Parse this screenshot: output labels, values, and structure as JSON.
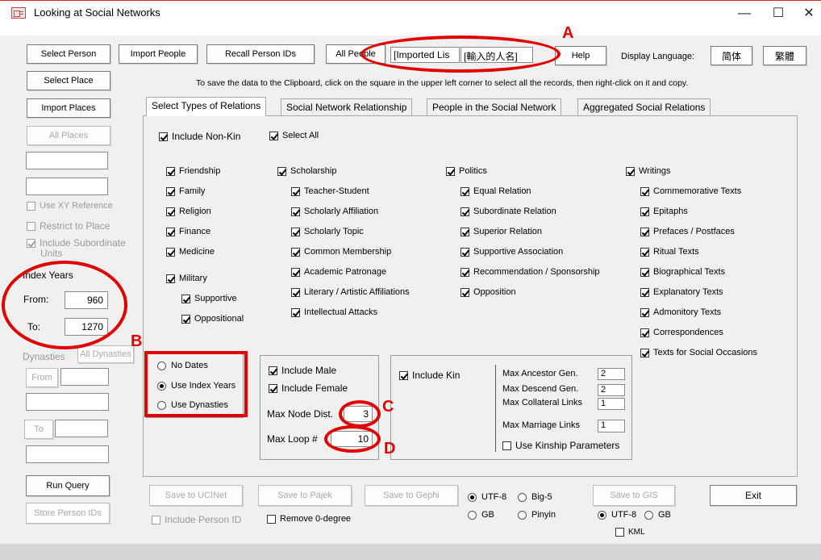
{
  "window": {
    "title": "Looking at Social Networks",
    "minimize": "—",
    "maximize": "☐",
    "close": "✕"
  },
  "toolbar": {
    "select_person": "Select Person",
    "import_people": "Import People",
    "recall_person_ids": "Recall Person IDs",
    "all_people": "All People",
    "imported_list_value": "[Imported Lis",
    "input_names_value": "[輸入的人名]",
    "help": "Help",
    "display_language_label": "Display Language:",
    "simplified": "简体",
    "traditional": "繁體"
  },
  "instruction": "To save the data to the Clipboard, click on the square in the upper left corner to select all the records, then right-click on it and copy.",
  "left": {
    "select_place": "Select Place",
    "import_places": "Import Places",
    "all_places": "All Places",
    "use_xy_reference": "Use XY Reference",
    "restrict_to_place": "Restrict to Place",
    "include_subordinate_units_1": "Include Subordinate",
    "include_subordinate_units_2": "Units",
    "index_years_label": "Index Years",
    "from_label": "From:",
    "from_value": "960",
    "to_label": "To:",
    "to_value": "1270",
    "dynasties_label": "Dynasties",
    "all_dynasties": "All Dynasties",
    "from_button": "From",
    "to_button": "To",
    "run_query": "Run Query",
    "store_person_ids": "Store Person IDs"
  },
  "tabs": [
    {
      "label": "Select Types of Relations"
    },
    {
      "label": "Social Network Relationship"
    },
    {
      "label": "People in the Social Network"
    },
    {
      "label": "Aggregated Social Relations"
    }
  ],
  "relations": {
    "include_non_kin": "Include Non-Kin",
    "select_all": "Select All",
    "col1": [
      "Friendship",
      "Family",
      "Religion",
      "Finance",
      "Medicine",
      "Military"
    ],
    "military_sub": [
      "Supportive",
      "Oppositional"
    ],
    "scholarship": "Scholarship",
    "scholarship_sub": [
      "Teacher-Student",
      "Scholarly Affiliation",
      "Scholarly Topic",
      "Common Membership",
      "Academic Patronage",
      "Literary / Artistic Affiliations",
      "Intellectual Attacks"
    ],
    "politics": "Politics",
    "politics_sub": [
      "Equal Relation",
      "Subordinate Relation",
      "Superior Relation",
      "Supportive Association",
      "Recommendation / Sponsorship",
      "Opposition"
    ],
    "writings": "Writings",
    "writings_sub": [
      "Commemorative Texts",
      "Epitaphs",
      "Prefaces / Postfaces",
      "Ritual Texts",
      "Biographical Texts",
      "Explanatory Texts",
      "Admonitory Texts",
      "Correspondences",
      "Texts for Social Occasions"
    ]
  },
  "dates": {
    "no_dates": "No Dates",
    "use_index_years": "Use Index Years",
    "use_dynasties": "Use Dynasties"
  },
  "node": {
    "include_male": "Include Male",
    "include_female": "Include Female",
    "max_node_dist_label": "Max Node Dist.",
    "max_node_dist_value": "3",
    "max_loop_label": "Max Loop #",
    "max_loop_value": "10"
  },
  "kin": {
    "include_kin": "Include Kin",
    "max_ancestor_label": "Max Ancestor Gen.",
    "max_ancestor_value": "2",
    "max_descend_label": "Max Descend Gen.",
    "max_descend_value": "2",
    "max_collateral_label": "Max Collateral Links",
    "max_collateral_value": "1",
    "max_marriage_label": "Max Marriage Links",
    "max_marriage_value": "1",
    "use_kinship_parameters": "Use Kinship Parameters"
  },
  "bottom": {
    "save_ucinet": "Save to UCINet",
    "save_pajek": "Save to Pajek",
    "save_gephi": "Save to Gephi",
    "include_person_id": "Include Person ID",
    "remove_0_degree": "Remove 0-degree",
    "utf8": "UTF-8",
    "big5": "Big-5",
    "gb": "GB",
    "pinyin": "Pinyin",
    "save_gis": "Save to GIS",
    "gis_utf8": "UTF-8",
    "gis_gb": "GB",
    "kml": "KML",
    "exit": "Exit"
  },
  "annotations": {
    "a": "A",
    "b": "B",
    "c": "C",
    "d": "D"
  }
}
